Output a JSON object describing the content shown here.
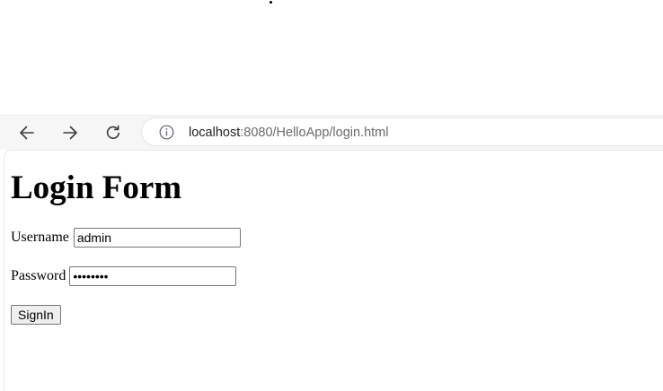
{
  "browser": {
    "url_host": "localhost",
    "url_rest": ":8080/HelloApp/login.html"
  },
  "page": {
    "title": "Login Form",
    "username_label": "Username",
    "username_value": "admin",
    "password_label": "Password",
    "password_value": "password",
    "signin_label": "SignIn"
  },
  "icons": {
    "back": "arrow-left-icon",
    "forward": "arrow-right-icon",
    "reload": "reload-icon",
    "site_info": "info-icon"
  }
}
